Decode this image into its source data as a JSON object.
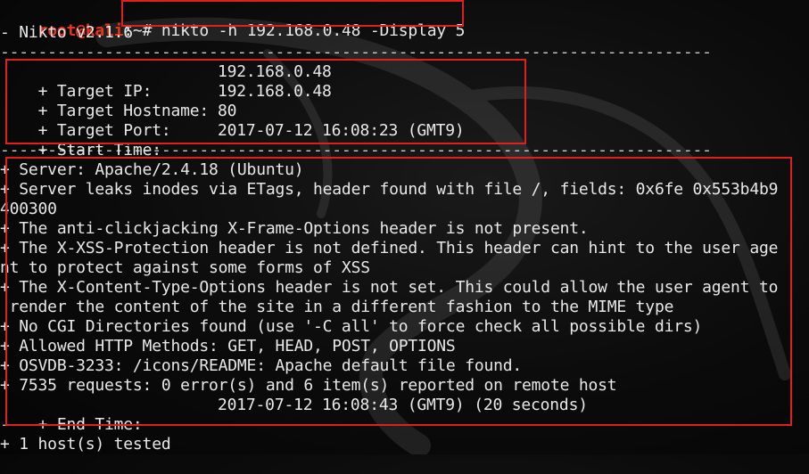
{
  "prompt": {
    "user_host": "root@kali",
    "path": ":~#",
    "command": "nikto -h 192.168.0.48 -Display 5"
  },
  "version_line": "- Nikto v2.1.6",
  "separator": "---------------------------------------------------------------------------",
  "target": {
    "ip_label": "+ Target IP:",
    "ip": "192.168.0.48",
    "hostname_label": "+ Target Hostname:",
    "hostname": "192.168.0.48",
    "port_label": "+ Target Port:",
    "port": "80",
    "start_label": "+ Start Time:",
    "start": "2017-07-12 16:08:23 (GMT9)"
  },
  "findings": [
    "+ Server: Apache/2.4.18 (Ubuntu)",
    "+ Server leaks inodes via ETags, header found with file /, fields: 0x6fe 0x553b4b9",
    "400300",
    "+ The anti-clickjacking X-Frame-Options header is not present.",
    "+ The X-XSS-Protection header is not defined. This header can hint to the user age",
    "nt to protect against some forms of XSS",
    "+ The X-Content-Type-Options header is not set. This could allow the user agent to",
    " render the content of the site in a different fashion to the MIME type",
    "+ No CGI Directories found (use '-C all' to force check all possible dirs)",
    "+ Allowed HTTP Methods: GET, HEAD, POST, OPTIONS",
    "+ OSVDB-3233: /icons/README: Apache default file found.",
    "+ 7535 requests: 0 error(s) and 6 item(s) reported on remote host"
  ],
  "end": {
    "label": "+ End Time:",
    "value": "2017-07-12 16:08:43 (GMT9) (20 seconds)"
  },
  "summary": "+ 1 host(s) tested",
  "colors": {
    "highlight_box": "#e0201e",
    "prompt": "#e8341c",
    "text": "#e8e8e8",
    "background": "#0b0b0b"
  }
}
